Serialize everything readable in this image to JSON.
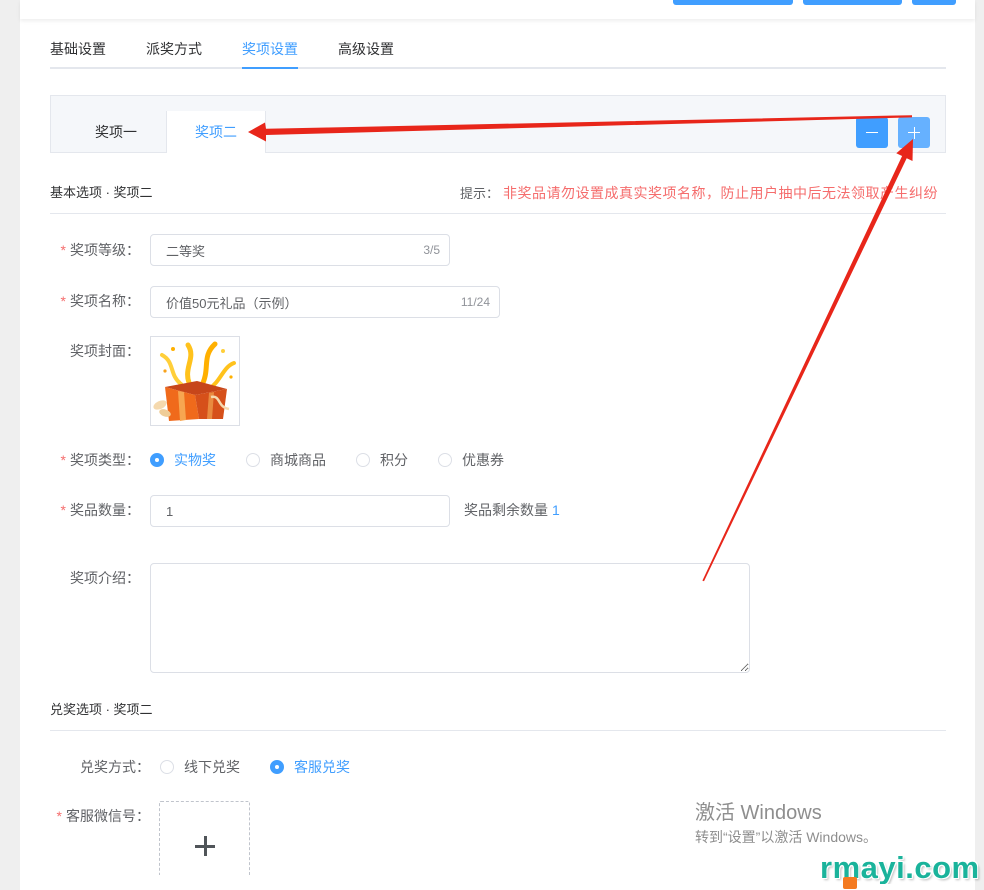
{
  "colors": {
    "primary": "#409eff",
    "primary_light": "#66b1ff",
    "danger": "#f56c6c",
    "annotation": "#e8261a",
    "watermark_site": "#1ab39b"
  },
  "required_mark": "*",
  "nav": {
    "active": 2,
    "tabs": [
      "基础设置",
      "派奖方式",
      "奖项设置",
      "高级设置"
    ]
  },
  "prize_tabs": {
    "active": 1,
    "items": [
      "奖项一",
      "奖项二"
    ],
    "remove_icon": "minus-icon",
    "add_icon": "plus-icon"
  },
  "basic_section": {
    "title": "基本选项 · 奖项二",
    "hint_label": "提示：",
    "hint_text": "非奖品请勿设置成真实奖项名称，防止用户抽中后无法领取产生纠纷"
  },
  "form": {
    "level": {
      "label": "奖项等级：",
      "value": "二等奖",
      "count": "3/5"
    },
    "name": {
      "label": "奖项名称：",
      "value": "价值50元礼品（示例）",
      "count": "11/24"
    },
    "cover": {
      "label": "奖项封面：",
      "image_icon": "gift-box-icon"
    },
    "type": {
      "label": "奖项类型：",
      "options": [
        "实物奖",
        "商城商品",
        "积分",
        "优惠券"
      ],
      "selected": 0
    },
    "quantity": {
      "label": "奖品数量：",
      "value": "1",
      "remaining_label": "奖品剩余数量",
      "remaining_value": "1"
    },
    "intro": {
      "label": "奖项介绍："
    }
  },
  "redeem_section": {
    "title": "兑奖选项 · 奖项二"
  },
  "redeem": {
    "method": {
      "label": "兑奖方式：",
      "options": [
        "线下兑奖",
        "客服兑奖"
      ],
      "selected": 1
    },
    "wechat": {
      "label": "客服微信号：",
      "upload_icon": "plus-icon"
    }
  },
  "watermarks": {
    "windows_title": "激活 Windows",
    "windows_sub": "转到“设置”以激活 Windows。",
    "site": "rmayi.com"
  }
}
